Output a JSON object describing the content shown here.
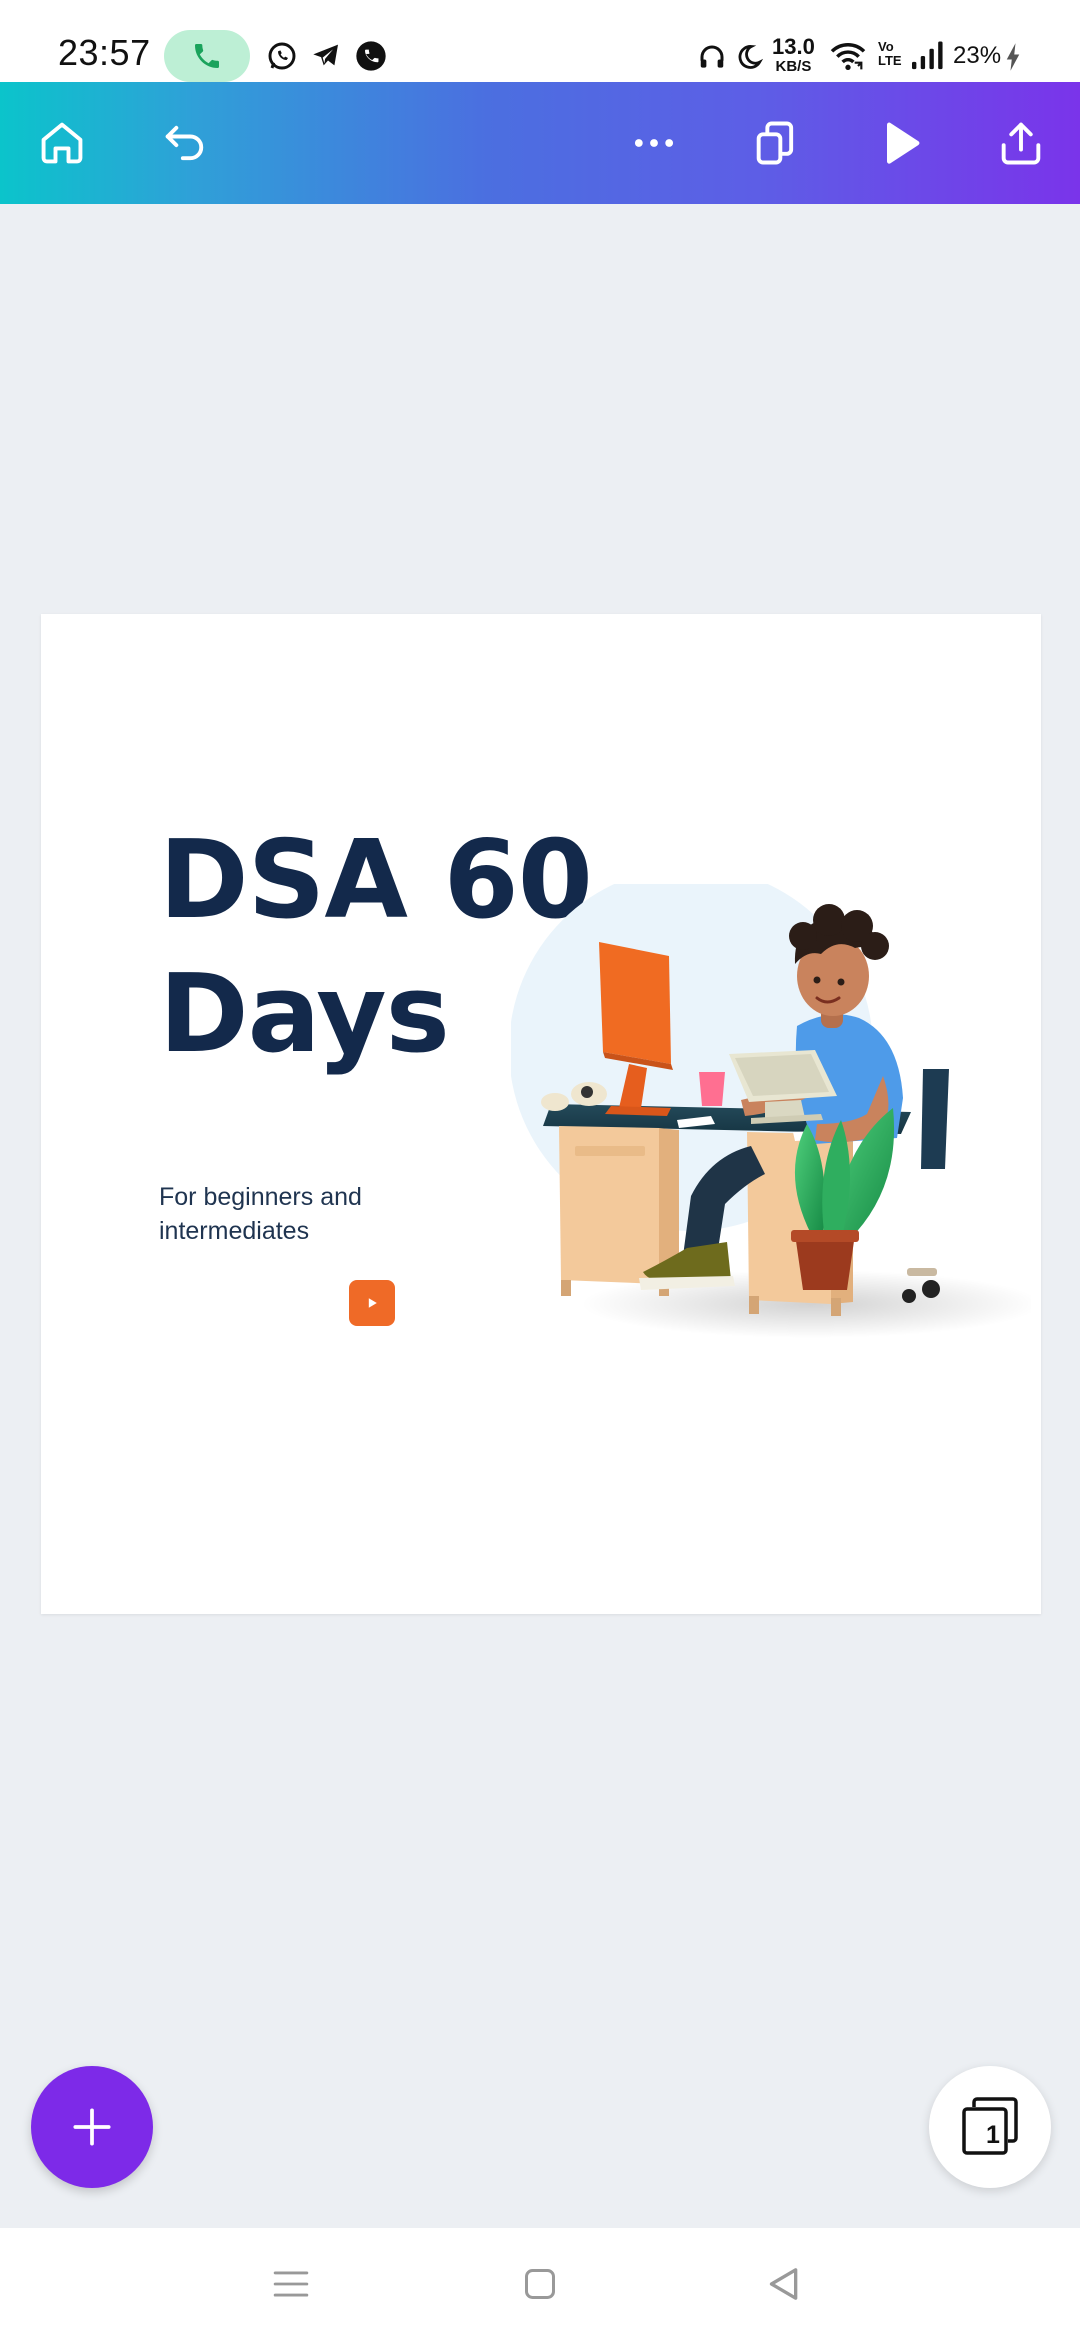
{
  "status_bar": {
    "time": "23:57",
    "network_speed_value": "13.0",
    "network_speed_unit": "KB/S",
    "volte_line1": "Vo",
    "volte_line2": "LTE",
    "battery": "23%",
    "icons": [
      "call-icon",
      "whatsapp-icon",
      "telegram-icon",
      "phone-app-icon",
      "headphones-icon",
      "moon-icon",
      "wifi-icon",
      "signal-icon",
      "charging-icon"
    ]
  },
  "toolbar": {
    "icons": [
      "home-icon",
      "undo-icon",
      "more-icon",
      "duplicate-icon",
      "play-icon",
      "share-icon"
    ]
  },
  "design": {
    "title_line1": "DSA 60",
    "title_line2": "Days",
    "subtitle": "For beginners and intermediates",
    "media_icon": "play-icon"
  },
  "floating": {
    "add_icon": "plus-icon",
    "pages_count": "1"
  },
  "nav_bar": {
    "icons": [
      "recents-icon",
      "home-square-icon",
      "back-triangle-icon"
    ]
  },
  "colors": {
    "title": "#13294b",
    "accent_orange": "#ef6a27",
    "fab_purple": "#7d2ae8",
    "toolbar_start": "#0bc4cb",
    "toolbar_end": "#7a34ea",
    "canvas_bg": "#eceff3"
  }
}
